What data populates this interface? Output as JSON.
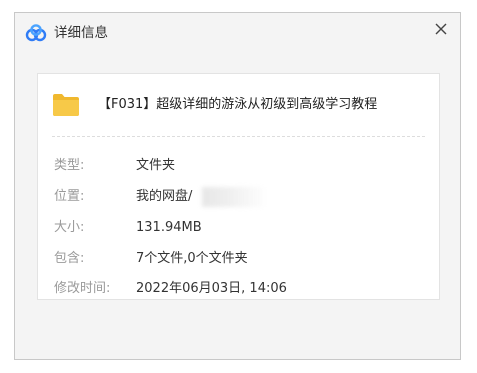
{
  "window": {
    "title": "详细信息",
    "close_glyph": "×",
    "icon": "baidu-netdisk-cloud-icon"
  },
  "item": {
    "icon": "folder-icon",
    "name": "【F031】超级详细的游泳从初级到高级学习教程"
  },
  "details": [
    {
      "label": "类型:",
      "value": "文件夹"
    },
    {
      "label": "位置:",
      "value": "我的网盘/"
    },
    {
      "label": "大小:",
      "value": "131.94MB"
    },
    {
      "label": "包含:",
      "value": "7个文件,0个文件夹"
    },
    {
      "label": "修改时间:",
      "value": "2022年06月03日, 14:06"
    }
  ],
  "colors": {
    "dialog_bg": "#f4f4f4",
    "card_bg": "#ffffff",
    "label": "#9a9a9a",
    "value": "#333333",
    "folder": "#f7c948",
    "logo_blue": "#2f7cf6"
  }
}
